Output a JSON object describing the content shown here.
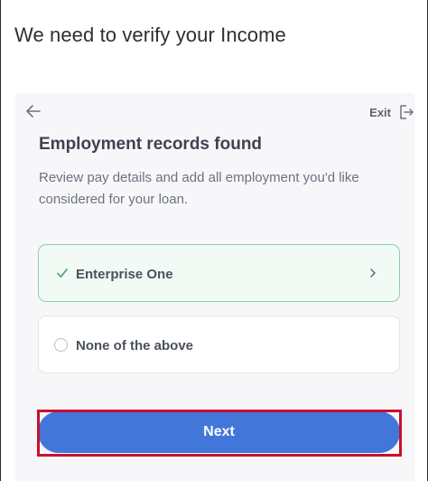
{
  "header": {
    "title": "We need to verify your Income"
  },
  "panel": {
    "back_icon": "arrow-left-icon",
    "exit_label": "Exit",
    "exit_icon": "exit-door-icon",
    "title": "Employment records found",
    "subtitle": "Review pay details and add all employment you'd like considered for your loan.",
    "options": [
      {
        "label": "Enterprise One",
        "selected": true,
        "icon": "checkmark-icon",
        "trailing_icon": "chevron-right-icon"
      },
      {
        "label": "None of the above",
        "selected": false,
        "icon": "radio-empty-icon"
      }
    ],
    "next_label": "Next"
  },
  "colors": {
    "primary": "#4277d9",
    "selected_border": "#8ad0a9",
    "selected_check": "#4fae77",
    "highlight": "#c8102e",
    "panel_bg": "#f7f7f9"
  }
}
